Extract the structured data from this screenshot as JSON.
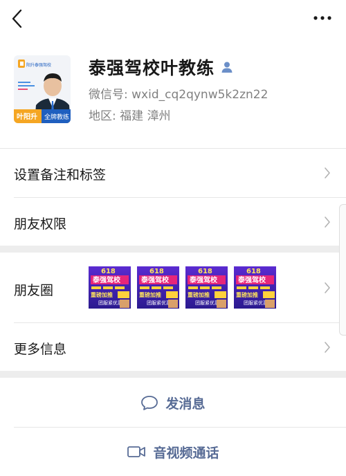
{
  "header": {
    "back_icon": "chevron-left-icon",
    "more_icon": "more-horizontal-icon"
  },
  "profile": {
    "name": "泰强驾校叶教练",
    "wechat_id": "微信号: wxid_cq2qynw5k2zn22",
    "region": "地区: 福建  漳州",
    "avatar": {
      "brand": "阳升泰强驾校",
      "person_name": "叶阳升",
      "tagline": "全牌教练"
    }
  },
  "menu": {
    "remarks_label": "设置备注和标签",
    "permissions_label": "朋友权限",
    "moments_label": "朋友圈",
    "more_info_label": "更多信息"
  },
  "moments_thumbs": [
    {
      "headline": "泰强驾校",
      "promo": "重磅加推",
      "badge": "618",
      "footer": "团服紧优惠"
    },
    {
      "headline": "泰强驾校",
      "promo": "重磅加推",
      "badge": "618",
      "footer": "团服紧优惠"
    },
    {
      "headline": "泰强驾校",
      "promo": "重磅加推",
      "badge": "618",
      "footer": "团服紧优惠"
    },
    {
      "headline": "泰强驾校",
      "promo": "重磅加推",
      "badge": "618",
      "footer": "团服紧优惠"
    }
  ],
  "actions": {
    "message_label": "发消息",
    "call_label": "音视频通话"
  },
  "colors": {
    "link": "#576b95",
    "secondary_text": "#808080",
    "divider": "#e6e6e6",
    "section_gap": "#ededed"
  }
}
